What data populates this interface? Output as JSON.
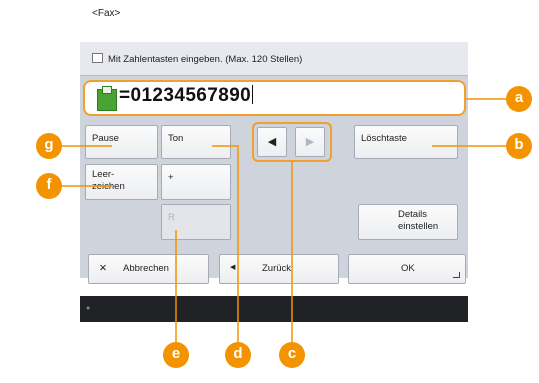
{
  "screen": {
    "title": "<Fax>",
    "hint": "Mit Zahlentasten eingeben. (Max. 120 Stellen)",
    "number": "=01234567890"
  },
  "keys": {
    "pause": "Pause",
    "ton": "Ton",
    "loeschtaste": "Löschtaste",
    "leerzeichen_l1": "Leer-",
    "leerzeichen_l2": "zeichen",
    "plus": "+",
    "r": "R",
    "details_l1": "Details",
    "details_l2": "einstellen"
  },
  "bottom": {
    "abbrechen": "Abbrechen",
    "zurueck": "Zurück",
    "ok": "OK"
  },
  "icons": {
    "cursor_left": "◀",
    "cursor_right": "▶",
    "close": "✕",
    "back": "◀"
  },
  "callouts": [
    "a",
    "b",
    "c",
    "d",
    "e",
    "f",
    "g"
  ],
  "colors": {
    "callout": "#f39300",
    "highlight": "#f0a030",
    "fax_icon": "#4aa233"
  }
}
